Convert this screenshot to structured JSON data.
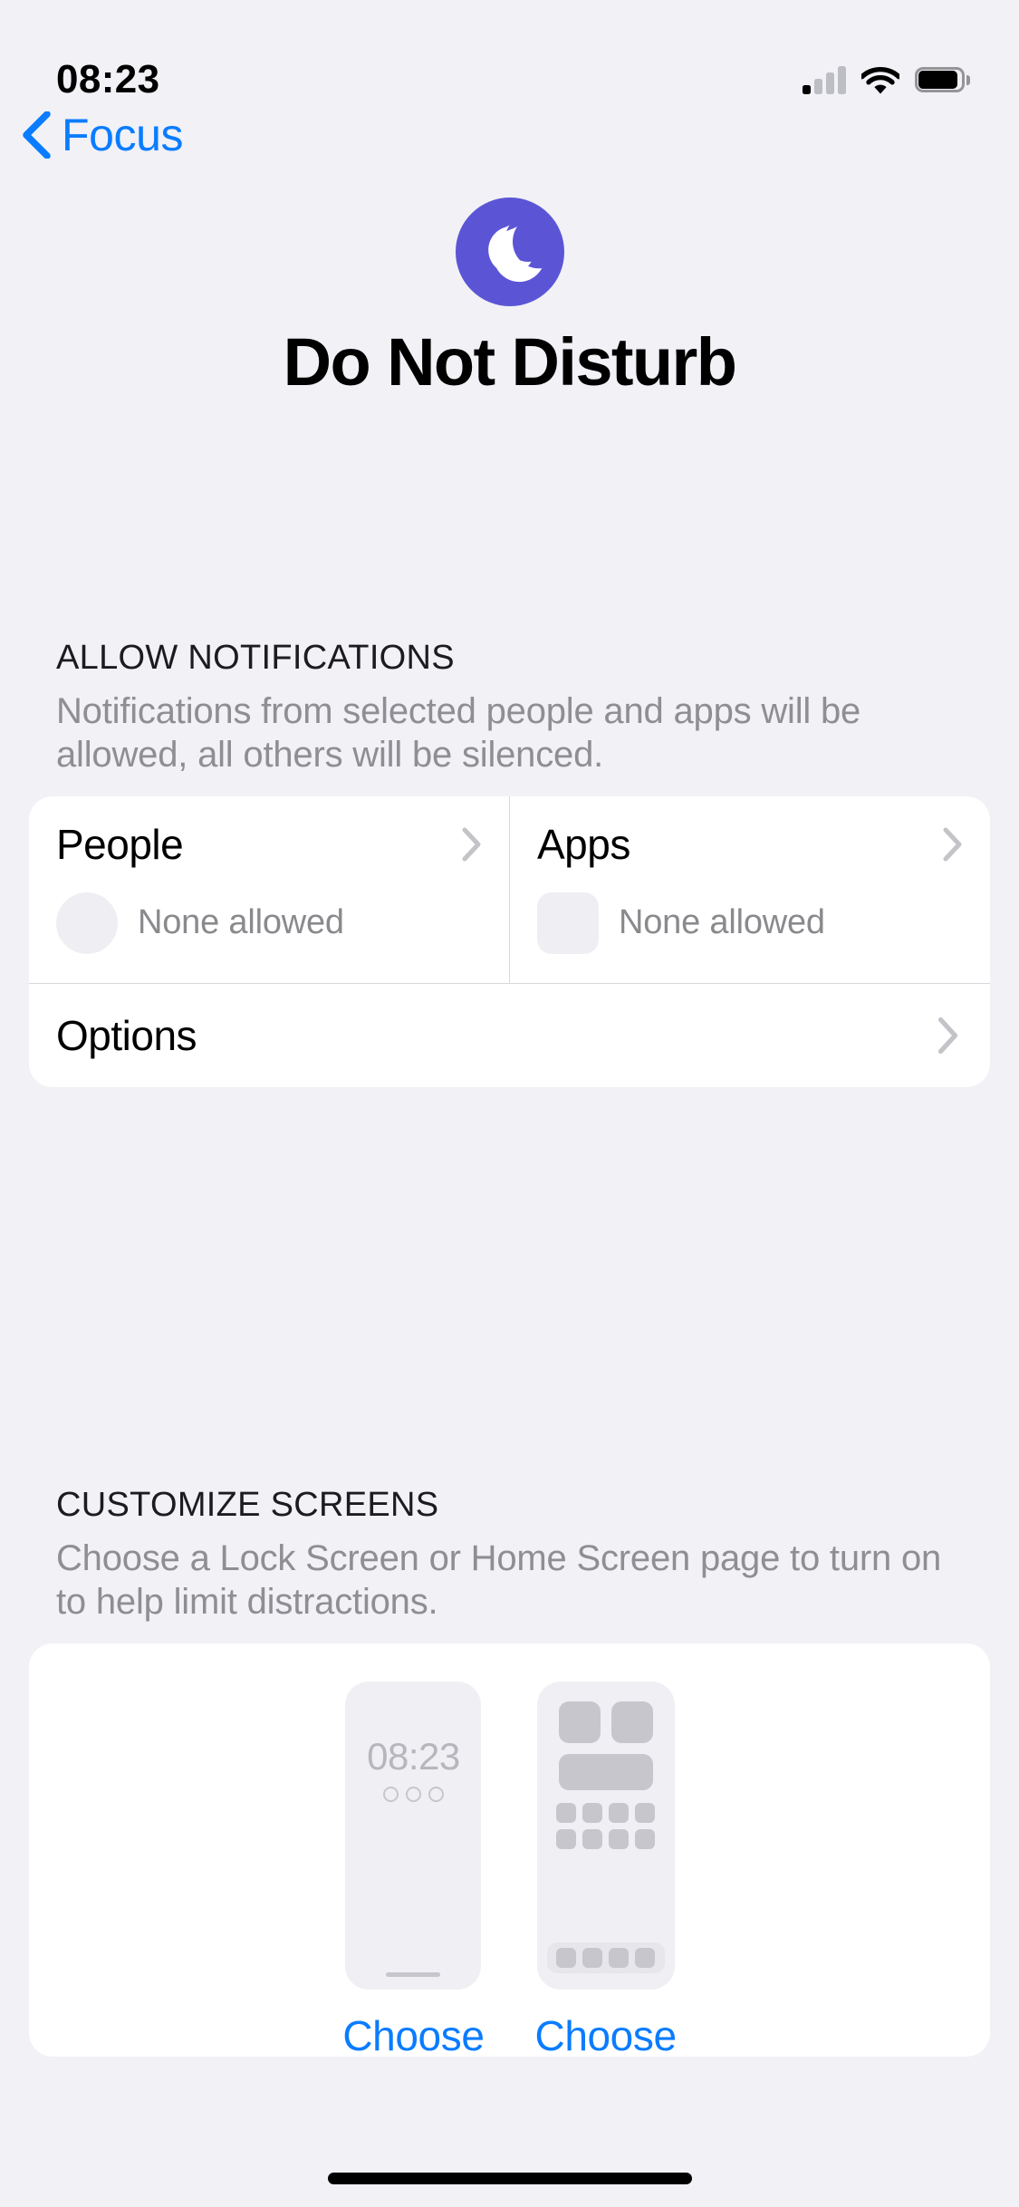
{
  "status_bar": {
    "time": "08:23",
    "cellular_icon": "cellular-signal-icon",
    "wifi_icon": "wifi-icon",
    "battery_icon": "battery-icon"
  },
  "nav": {
    "back_label": "Focus",
    "back_icon": "chevron-left-icon"
  },
  "hero": {
    "icon": "crescent-moon-icon",
    "icon_color": "#5B55D6",
    "title": "Do Not Disturb"
  },
  "allow_notifications": {
    "header": "ALLOW NOTIFICATIONS",
    "description": "Notifications from selected people and apps will be allowed, all others will be silenced.",
    "cells": [
      {
        "title": "People",
        "subtitle": "None allowed",
        "placeholder": "circle",
        "chevron": "chevron-right-icon"
      },
      {
        "title": "Apps",
        "subtitle": "None allowed",
        "placeholder": "rounded-square",
        "chevron": "chevron-right-icon"
      }
    ],
    "options_row": {
      "title": "Options",
      "chevron": "chevron-right-icon"
    }
  },
  "customize_screens": {
    "header": "CUSTOMIZE SCREENS",
    "description": "Choose a Lock Screen or Home Screen page to turn on to help limit distractions.",
    "lock_screen": {
      "preview_time": "08:23",
      "preview_widget_count": 3,
      "choose_label": "Choose"
    },
    "home_screen": {
      "choose_label": "Choose"
    }
  },
  "colors": {
    "accent_blue": "#0A7CFF",
    "focus_purple": "#5B55D6",
    "background": "#F1F1F6",
    "card": "#FFFFFF",
    "secondary_text": "#8E8E93"
  }
}
